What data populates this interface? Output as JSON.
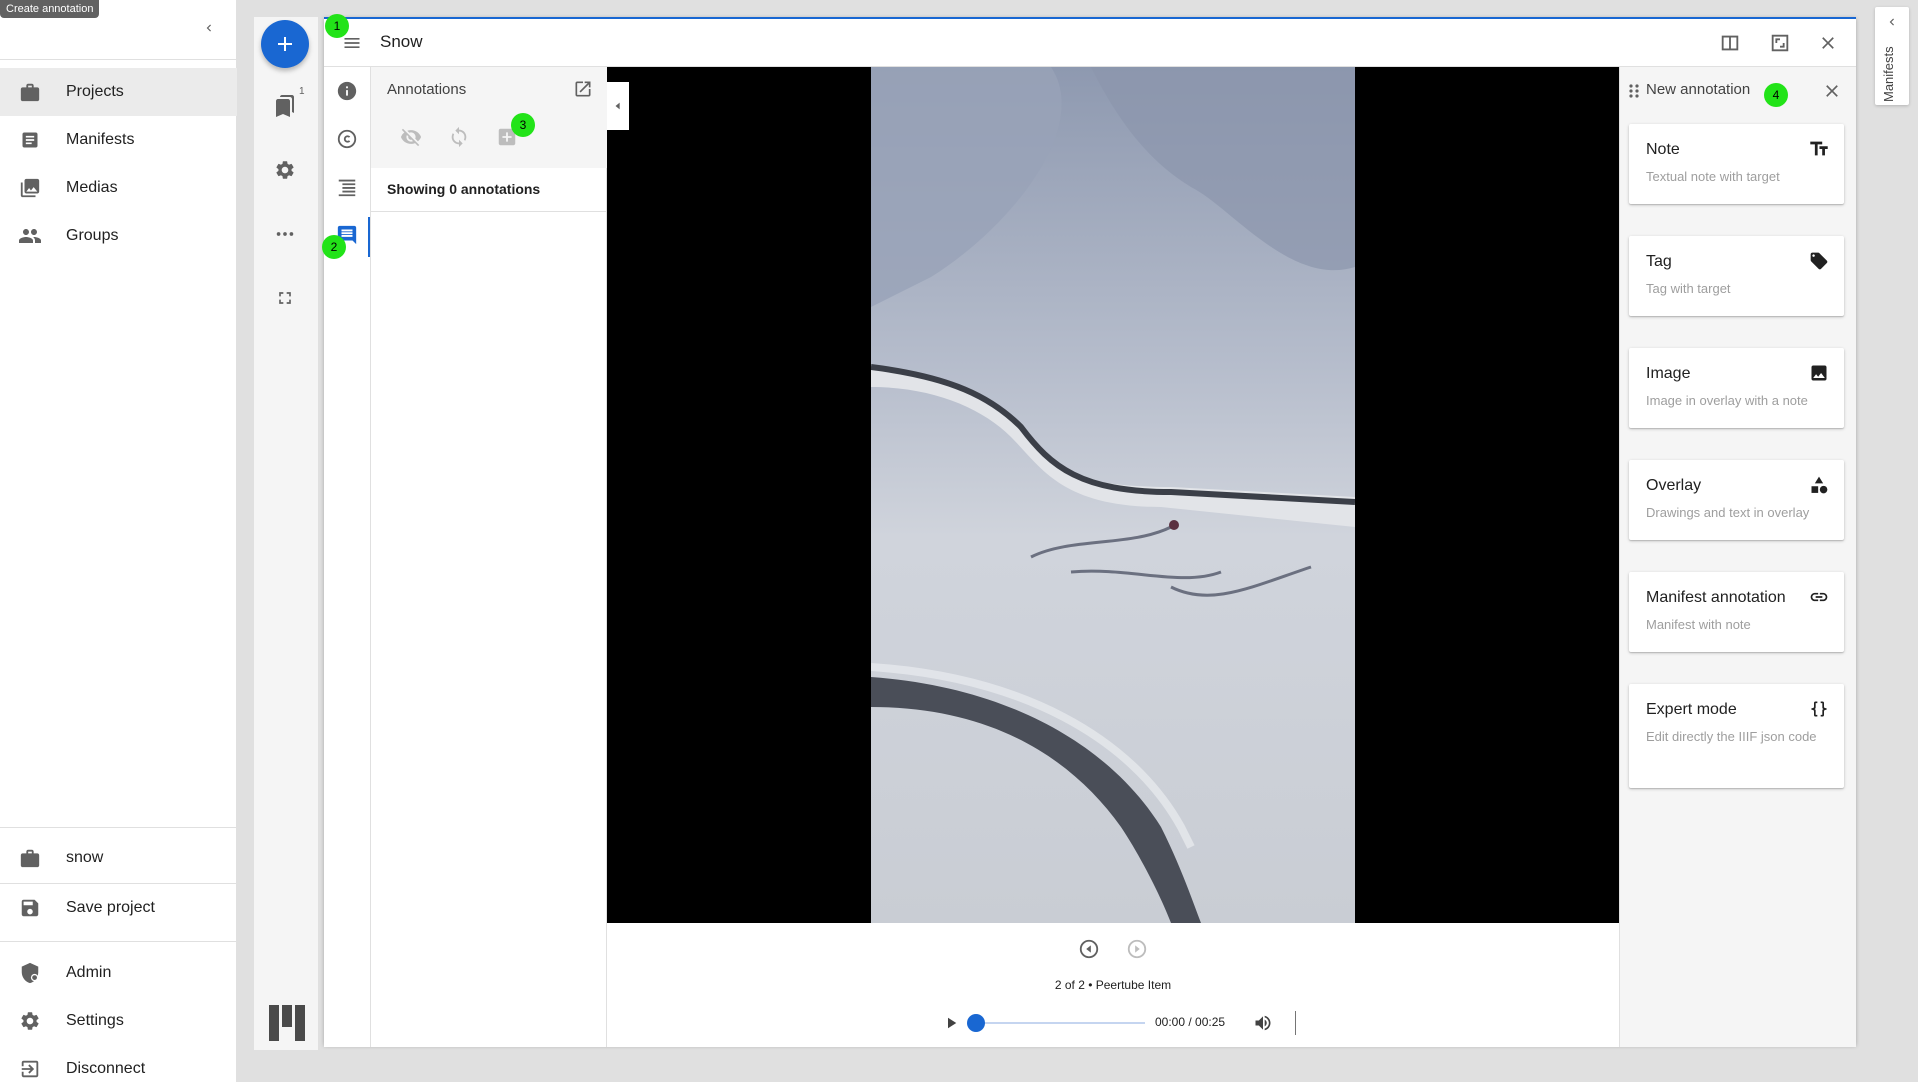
{
  "tooltip": "Create annotation",
  "drawer": {
    "nav": [
      {
        "label": "Projects",
        "icon": "briefcase-icon",
        "active": true
      },
      {
        "label": "Manifests",
        "icon": "document-icon"
      },
      {
        "label": "Medias",
        "icon": "photo-library-icon"
      },
      {
        "label": "Groups",
        "icon": "people-icon"
      }
    ],
    "bottom": [
      {
        "label": "snow",
        "icon": "briefcase-icon"
      },
      {
        "label": "Save project",
        "icon": "save-icon"
      },
      {
        "label": "Admin",
        "icon": "admin-shield-icon"
      },
      {
        "label": "Settings",
        "icon": "gear-icon"
      },
      {
        "label": "Disconnect",
        "icon": "logout-icon"
      }
    ]
  },
  "workspace": {
    "bookmark_count": "1"
  },
  "window": {
    "title": "Snow",
    "annotations_panel": {
      "title": "Annotations",
      "count_text": "Showing 0 annotations"
    },
    "canvas_label": "2 of 2 • Peertube Item",
    "player": {
      "time": "00:00 / 00:25",
      "progress": 0
    },
    "new_annotation": {
      "title": "New annotation",
      "cards": [
        {
          "title": "Note",
          "desc": "Textual note with target",
          "icon": "text-format-icon"
        },
        {
          "title": "Tag",
          "desc": "Tag with target",
          "icon": "tag-icon"
        },
        {
          "title": "Image",
          "desc": "Image in overlay with a note",
          "icon": "image-icon"
        },
        {
          "title": "Overlay",
          "desc": "Drawings and text in overlay",
          "icon": "shapes-icon"
        },
        {
          "title": "Manifest annotation",
          "desc": "Manifest with note",
          "icon": "link-icon"
        },
        {
          "title": "Expert mode",
          "desc": "Edit directly the IIIF json code",
          "icon": "code-braces-icon"
        }
      ]
    }
  },
  "manifests_tab": "Manifests",
  "badges": [
    "1",
    "2",
    "3",
    "4"
  ],
  "colors": {
    "primary": "#1967d2",
    "badge": "#22e318"
  }
}
